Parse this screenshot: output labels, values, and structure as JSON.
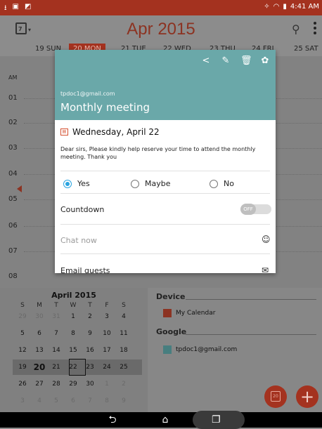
{
  "statusbar": {
    "time": "4:41 AM"
  },
  "appbar": {
    "title": "Apr 2015",
    "date_icon_text": "7"
  },
  "days": [
    {
      "label": "19 SUN"
    },
    {
      "label": "20 MON"
    },
    {
      "label": "21 TUE"
    },
    {
      "label": "22 WED"
    },
    {
      "label": "23 THU"
    },
    {
      "label": "24 FRI"
    },
    {
      "label": "25 SAT"
    }
  ],
  "hours": [
    "AM",
    "01",
    "02",
    "03",
    "04",
    "05",
    "06",
    "07",
    "08"
  ],
  "mini_calendar": {
    "title": "April 2015",
    "dow": [
      "S",
      "M",
      "T",
      "W",
      "T",
      "F",
      "S"
    ],
    "weeks": [
      [
        "29",
        "30",
        "31",
        "1",
        "2",
        "3",
        "4"
      ],
      [
        "5",
        "6",
        "7",
        "8",
        "9",
        "10",
        "11"
      ],
      [
        "12",
        "13",
        "14",
        "15",
        "16",
        "17",
        "18"
      ],
      [
        "19",
        "20",
        "21",
        "22",
        "23",
        "24",
        "25"
      ],
      [
        "26",
        "27",
        "28",
        "29",
        "30",
        "1",
        "2"
      ],
      [
        "3",
        "4",
        "5",
        "6",
        "7",
        "8",
        "9"
      ]
    ]
  },
  "panel": {
    "device_header": "Device",
    "device_item": "My Calendar",
    "google_header": "Google",
    "google_item": "tpdoc1@gmail.com"
  },
  "colors": {
    "accent": "#a4321f",
    "dialog_header": "#6aa8a9",
    "radio_on": "#2aa4e0"
  },
  "dialog": {
    "email": "tpdoc1@gmail.com",
    "title": "Monthly meeting",
    "date": "Wednesday, April 22",
    "description": "Dear sirs, Please kindly help reserve your time to attend the monthly meeting. Thank you",
    "rsvp": {
      "yes": "Yes",
      "maybe": "Maybe",
      "no": "No",
      "selected": "Yes"
    },
    "countdown_label": "Countdown",
    "countdown_toggle": "OFF",
    "chat_placeholder": "Chat now",
    "email_guests": "Email guests",
    "icons": [
      "share-icon",
      "edit-icon",
      "delete-icon",
      "palette-icon"
    ]
  },
  "fab": {
    "calendar_icon_text": "20",
    "add_icon": "+"
  }
}
